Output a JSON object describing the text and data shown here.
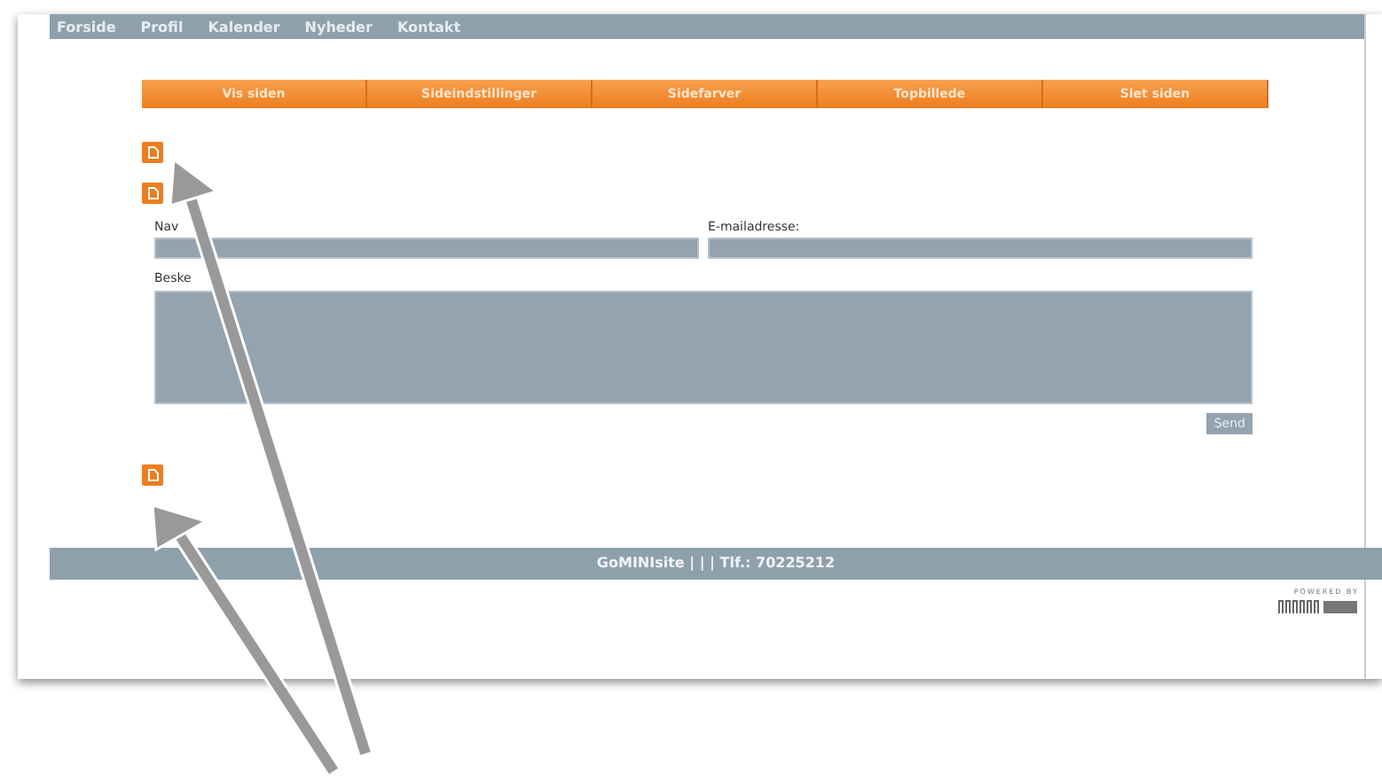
{
  "top_nav": [
    "Forside",
    "Profil",
    "Kalender",
    "Nyheder",
    "Kontakt"
  ],
  "menu": [
    {
      "label": "Vis siden"
    },
    {
      "label": "Sideindstillinger"
    },
    {
      "label": "Sidefarver"
    },
    {
      "label": "Topbillede"
    },
    {
      "label": "Slet siden"
    }
  ],
  "form": {
    "name_label": "Nav",
    "email_label": "E-mailadresse:",
    "message_label": "Beske",
    "send_button": "Send"
  },
  "footer": "GoMINIsite | | | Tlf.: 70225212",
  "powered_by": "POWERED BY"
}
